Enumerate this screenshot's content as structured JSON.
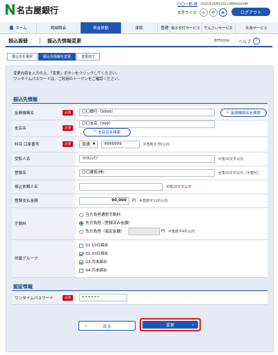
{
  "header": {
    "bank_name": "名古屋銀行",
    "user_name": "〇〇一郎 様",
    "last_login": "20XX年09月20日 10時00分00秒",
    "font_size_label": "文字サイズ",
    "font_small": "小",
    "font_medium": "中",
    "font_large": "大",
    "logout_label": "ログアウト"
  },
  "nav": {
    "items": [
      {
        "label": "ホーム",
        "icon": "home-icon"
      },
      {
        "label": "明細照会"
      },
      {
        "label": "資金移動"
      },
      {
        "label": "承認"
      },
      {
        "label": "管理"
      },
      {
        "label": "電子交付サービス"
      },
      {
        "label": "でんさいサービス"
      },
      {
        "label": "外為サービス"
      }
    ],
    "active_index": 2
  },
  "page": {
    "title_section": "振込振替",
    "title": "振込先情報変更",
    "screen_id": "BFFK004",
    "help_label": "ヘルプ",
    "help_icon": "question-icon"
  },
  "steps": [
    "振込先を選択",
    "振込先情報を変更",
    "変更完了"
  ],
  "steps_active": 1,
  "instructions": {
    "line1": "変更内容を入力の上、「変更」ボタンをクリックしてください。",
    "line2": "ワンタイムパスワードは、ご利用のトークンをご確認ください。"
  },
  "section_payee": {
    "heading": "振込先情報",
    "required_label": "必須",
    "bank": {
      "label": "金融機関名",
      "value": "〇〇銀行（9999）",
      "button": "金融機関名を検索"
    },
    "branch": {
      "label": "支店名",
      "value": "〇〇支店（999）",
      "button": "支店名を検索"
    },
    "account": {
      "label": "科目 口座番号",
      "type": "普通",
      "number": "9999999",
      "note": "半角数字7桁以内"
    },
    "recipient": {
      "label": "受取人名",
      "value": "ﾏﾙﾏﾙｼｮｳｼﾞ",
      "note": "半角30文字以内"
    },
    "registered": {
      "label": "登録名",
      "value": "〇〇建設(株)",
      "note": "全角30文字以内［半角可］"
    },
    "requester": {
      "label": "振込依頼人名",
      "value": "",
      "note": "半角20文字以内"
    },
    "amount": {
      "label": "登録支払金額",
      "value": "90,000",
      "unit": "円",
      "note": "半角数字11桁以内"
    },
    "fee": {
      "label": "手数料",
      "options": [
        "当方負担通常手数料",
        "先方負担（登録済み金額）",
        "先方負担（指定金額）"
      ],
      "selected": 1,
      "unit": "円",
      "note": "半角数字4桁以内"
    },
    "group": {
      "label": "所属グループ",
      "options": [
        "01 10日締め",
        "02 20日締め",
        "03 月末締め",
        "04 月末締め"
      ],
      "checked": [
        false,
        true,
        true,
        false
      ]
    }
  },
  "section_auth": {
    "heading": "認証情報",
    "otp_label": "ワンタイムパスワード",
    "otp_value": "••••••"
  },
  "buttons": {
    "back": "戻る",
    "change": "変更"
  },
  "colors": {
    "primary": "#1e56b0",
    "required": "#d0021b",
    "highlight": "#e0191f",
    "brand_green": "#1a8a3a"
  }
}
